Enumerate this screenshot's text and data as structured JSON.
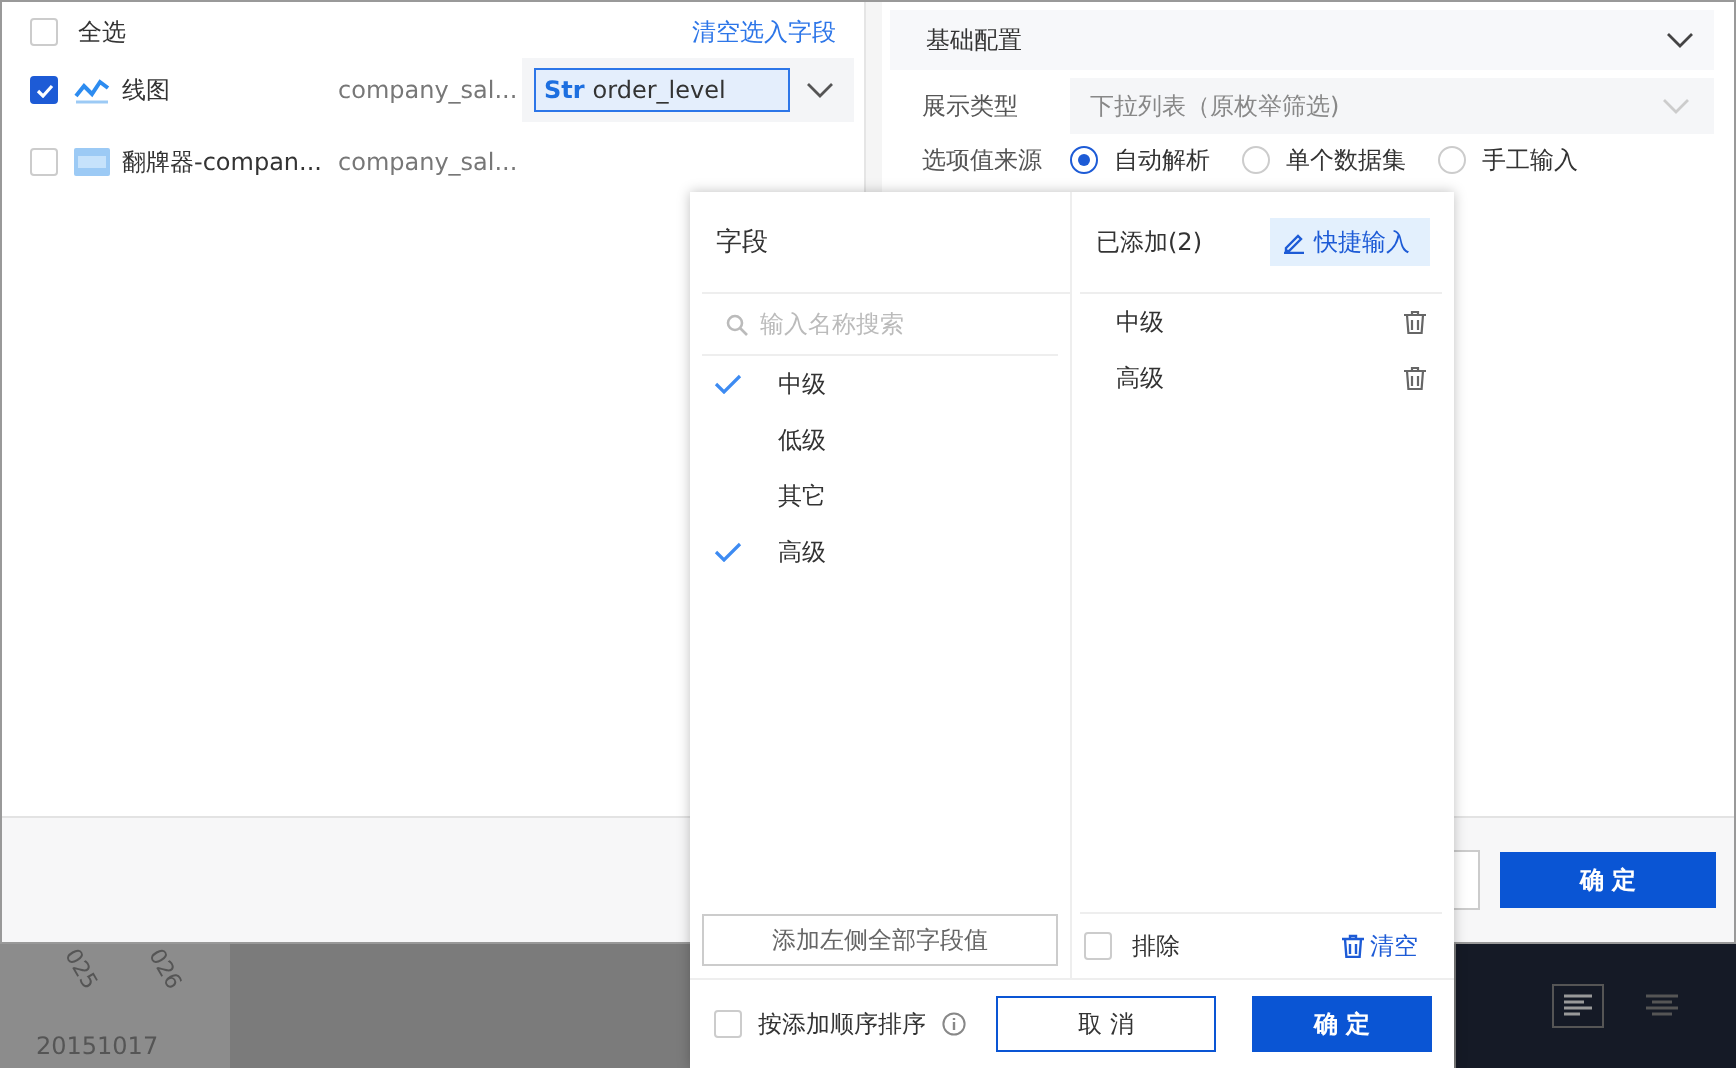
{
  "left_pane": {
    "select_all": {
      "label": "全选",
      "checked": false
    },
    "clear_link": "清空选入字段",
    "rows": [
      {
        "kind": "line",
        "name": "线图",
        "dataset": "company_sal...",
        "checked": true,
        "field": {
          "type": "Str",
          "name": "order_level"
        }
      },
      {
        "kind": "flip",
        "name": "翻牌器-compan...",
        "dataset": "company_sal...",
        "checked": false
      }
    ]
  },
  "right_pane": {
    "section": {
      "title": "基础配置",
      "expanded": true
    },
    "display_type": {
      "label": "展示类型",
      "value": "下拉列表（原枚举筛选)"
    },
    "source": {
      "label": "选项值来源",
      "options": [
        {
          "label": "自动解析",
          "selected": true
        },
        {
          "label": "单个数据集",
          "selected": false
        },
        {
          "label": "手工输入",
          "selected": false
        }
      ]
    }
  },
  "dialog_footer": {
    "confirm": "确 定"
  },
  "backdrop": {
    "axis_labels": [
      "025",
      "026"
    ],
    "date": "20151017"
  },
  "popup": {
    "fields_title": "字段",
    "search_placeholder": "输入名称搜索",
    "values": [
      {
        "label": "中级",
        "checked": true
      },
      {
        "label": "低级",
        "checked": false
      },
      {
        "label": "其它",
        "checked": false
      },
      {
        "label": "高级",
        "checked": true
      }
    ],
    "add_all": "添加左侧全部字段值",
    "added_title": "已添加(2)",
    "quick_input": "快捷输入",
    "added": [
      "中级",
      "高级"
    ],
    "exclude": {
      "label": "排除",
      "checked": false
    },
    "clear": "清空",
    "sort": {
      "label": "按添加顺序排序",
      "checked": false
    },
    "cancel": "取 消",
    "ok": "确 定"
  }
}
